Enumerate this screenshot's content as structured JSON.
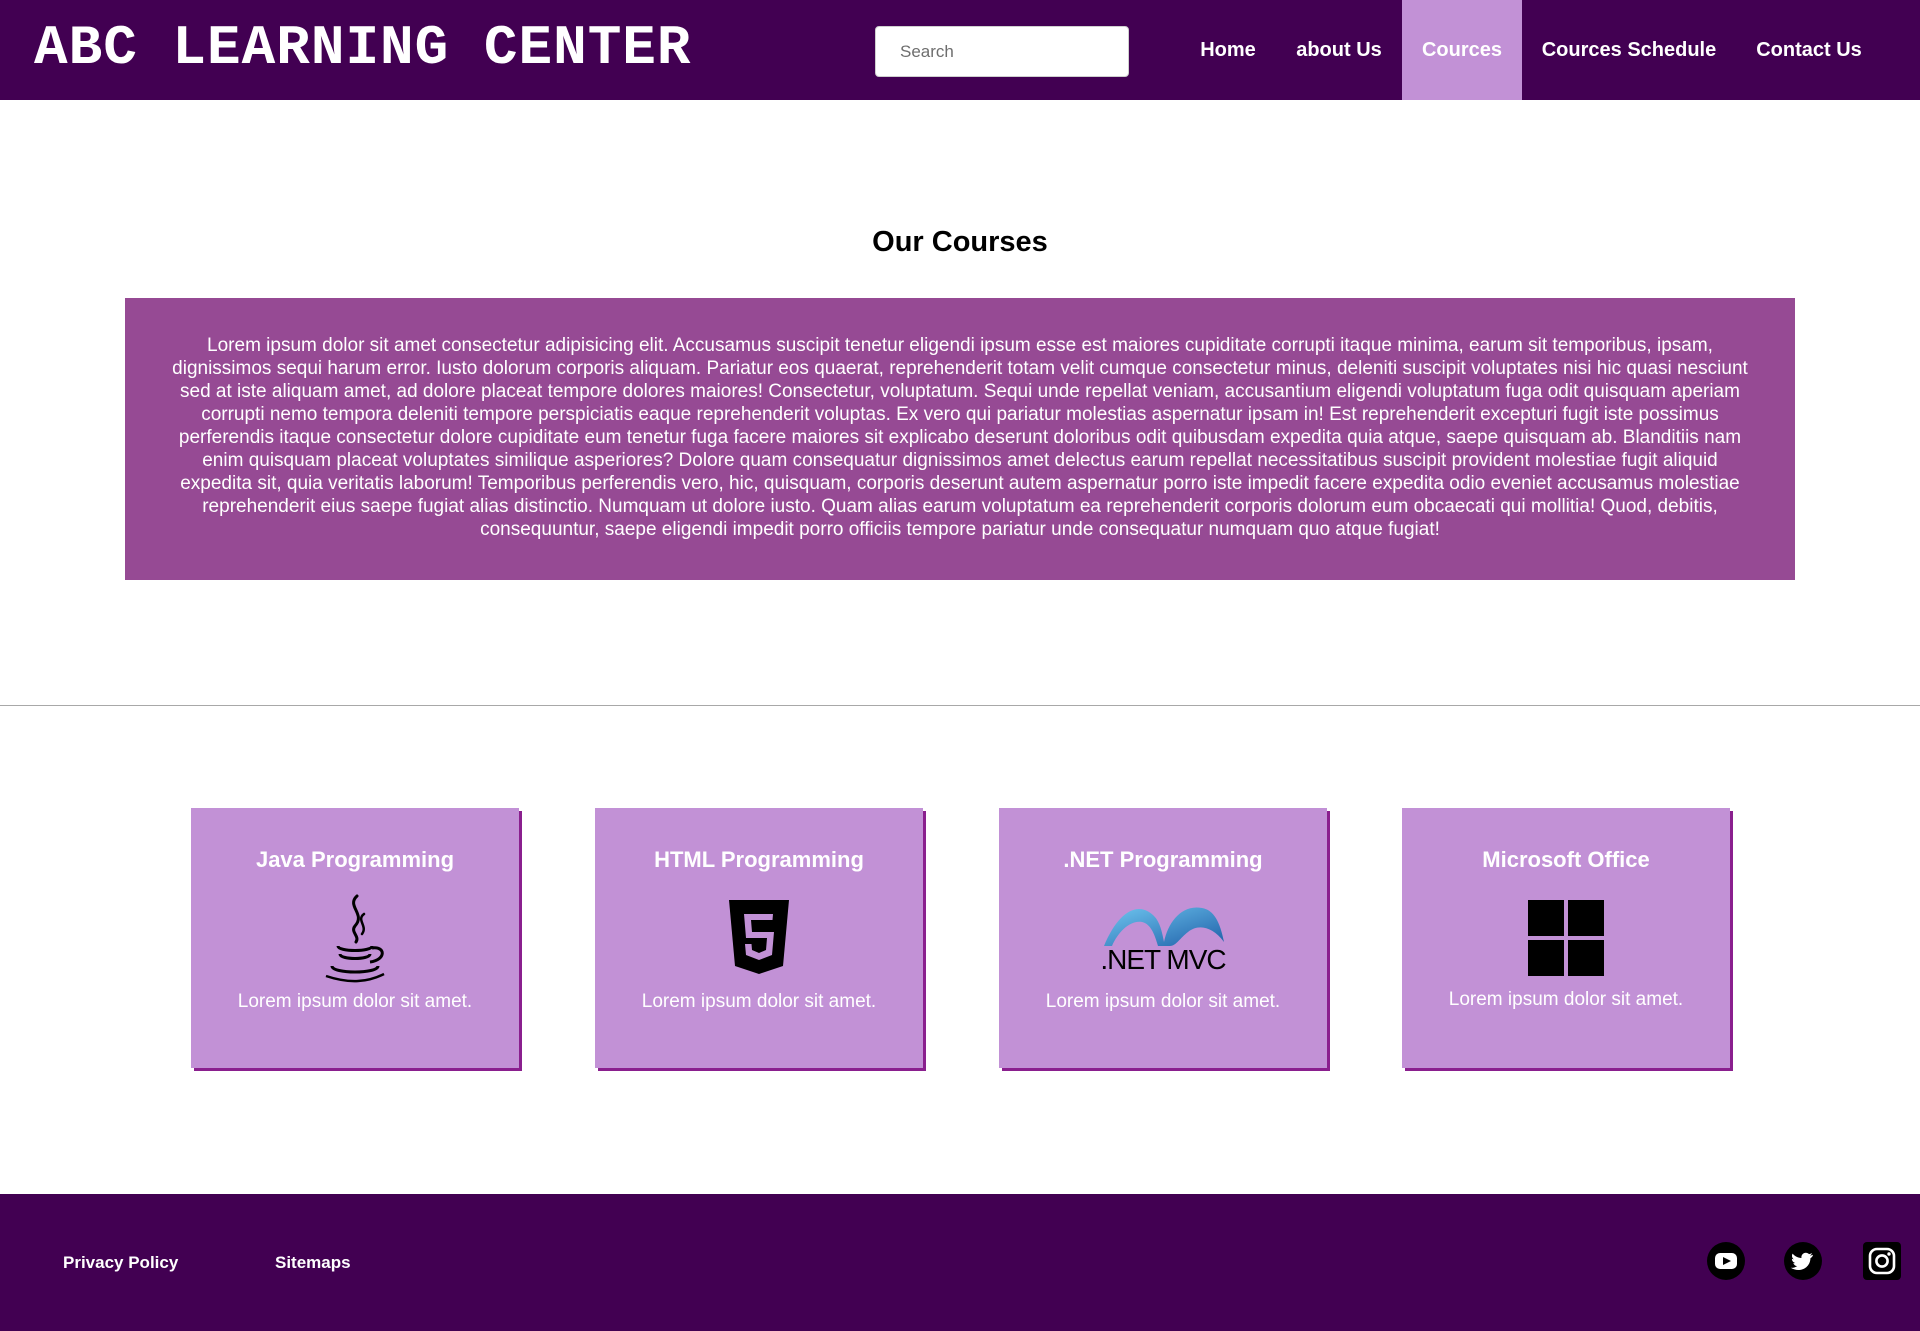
{
  "header": {
    "brand": "ABC LEARNING CENTER",
    "search_placeholder": "Search",
    "nav": [
      {
        "label": "Home",
        "active": false
      },
      {
        "label": "about Us",
        "active": false
      },
      {
        "label": "Cources",
        "active": true
      },
      {
        "label": "Cources Schedule",
        "active": false
      },
      {
        "label": "Contact Us",
        "active": false
      }
    ]
  },
  "intro": {
    "title": "Our Courses",
    "body": "Lorem ipsum dolor sit amet consectetur adipisicing elit. Accusamus suscipit tenetur eligendi ipsum esse est maiores cupiditate corrupti itaque minima, earum sit temporibus, ipsam, dignissimos sequi harum error. Iusto dolorum corporis aliquam. Pariatur eos quaerat, reprehenderit totam velit cumque consectetur minus, deleniti suscipit voluptates nisi hic quasi nesciunt sed at iste aliquam amet, ad dolore placeat tempore dolores maiores! Consectetur, voluptatum. Sequi unde repellat veniam, accusantium eligendi voluptatum fuga odit quisquam aperiam corrupti nemo tempora deleniti tempore perspiciatis eaque reprehenderit voluptas. Ex vero qui pariatur molestias aspernatur ipsam in! Est reprehenderit excepturi fugit iste possimus perferendis itaque consectetur dolore cupiditate eum tenetur fuga facere maiores sit explicabo deserunt doloribus odit quibusdam expedita quia atque, saepe quisquam ab. Blanditiis nam enim quisquam placeat voluptates similique asperiores? Dolore quam consequatur dignissimos amet delectus earum repellat necessitatibus suscipit provident molestiae fugit aliquid expedita sit, quia veritatis laborum! Temporibus perferendis vero, hic, quisquam, corporis deserunt autem aspernatur porro iste impedit facere expedita odio eveniet accusamus molestiae reprehenderit eius saepe fugiat alias distinctio. Numquam ut dolore iusto. Quam alias earum voluptatum ea reprehenderit corporis dolorum eum obcaecati qui mollitia! Quod, debitis, consequuntur, saepe eligendi impedit porro officiis tempore pariatur unde consequatur numquam quo atque fugiat!"
  },
  "courses": [
    {
      "title": "Java Programming",
      "icon": "java-icon",
      "text": "Lorem ipsum dolor sit amet."
    },
    {
      "title": "HTML Programming",
      "icon": "html5-icon",
      "text": "Lorem ipsum dolor sit amet."
    },
    {
      "title": ".NET Programming",
      "icon": "dotnet-mvc-logo",
      "icon_text": ".NET MVC",
      "text": "Lorem ipsum dolor sit amet."
    },
    {
      "title": "Microsoft Office",
      "icon": "windows-icon",
      "text": "Lorem ipsum dolor sit amet."
    }
  ],
  "footer": {
    "links": [
      "Privacy Policy",
      "Sitemaps"
    ],
    "social": [
      "youtube-icon",
      "twitter-icon",
      "instagram-icon"
    ]
  },
  "colors": {
    "header_bg": "#420052",
    "active_nav_bg": "#c291d6",
    "intro_bg": "#964a94",
    "card_bg": "#c291d6",
    "card_shadow": "#8a1f8e"
  }
}
